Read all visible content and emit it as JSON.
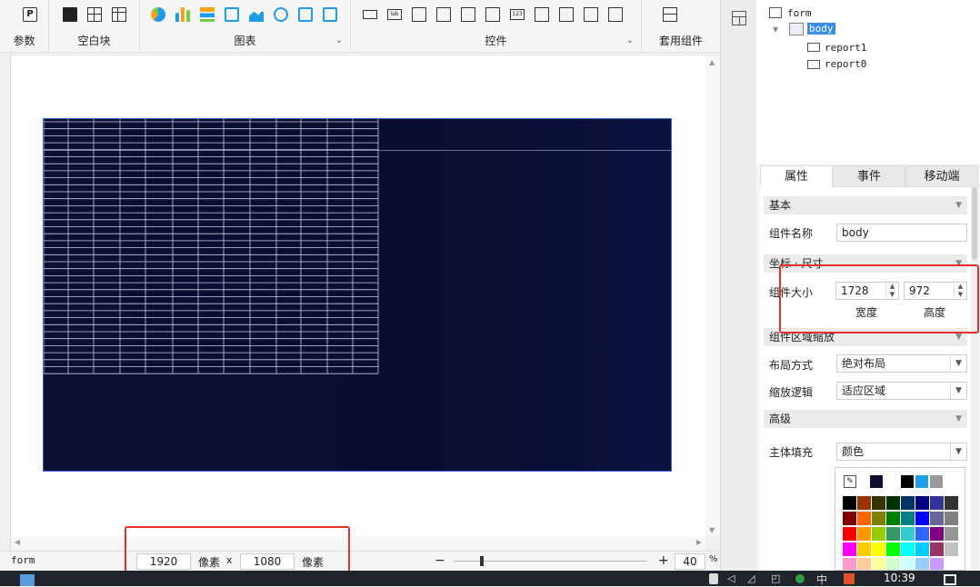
{
  "toolbar": {
    "groups": [
      {
        "label": "参数"
      },
      {
        "label": "空白块"
      },
      {
        "label": "图表"
      },
      {
        "label": "控件"
      },
      {
        "label": "套用组件"
      }
    ],
    "chart_icon_names": [
      "pie-chart-icon",
      "bar-chart-icon",
      "horizontal-bar-icon",
      "line-chart-icon",
      "area-chart-icon",
      "gauge-icon",
      "radar-chart-icon",
      "scatter-chart-icon"
    ],
    "widget_icon_names": [
      "button-icon",
      "label-icon",
      "textbox-icon",
      "combobox-icon",
      "tree-combobox-icon",
      "date-icon",
      "number-icon",
      "textarea-icon",
      "radio-group-icon",
      "checkbox-group-icon",
      "query-icon"
    ],
    "widget_lab_text": "lab",
    "widget_123_text": "123"
  },
  "status": {
    "form_label": "form",
    "width_value": "1920",
    "unit1": "像素",
    "times": "x",
    "height_value": "1080",
    "unit2": "像素",
    "minus": "−",
    "plus": "+",
    "zoom": "40",
    "percent": "%"
  },
  "tree": {
    "root": "form",
    "body": "body",
    "children": [
      "report1",
      "report0"
    ]
  },
  "tabs": [
    "属性",
    "事件",
    "移动端"
  ],
  "props": {
    "basic_section": "基本",
    "name_label": "组件名称",
    "name_value": "body",
    "coord_section": "坐标 · 尺寸",
    "size_label": "组件大小",
    "width_value": "1728",
    "height_value": "972",
    "width_caption": "宽度",
    "height_caption": "高度",
    "scale_section": "组件区域缩放",
    "layout_label": "布局方式",
    "layout_value": "绝对布局",
    "scale_label": "缩放逻辑",
    "scale_value": "适应区域",
    "advanced_section": "高级",
    "fill_label": "主体填充",
    "fill_value": "颜色"
  },
  "palette": {
    "top_row": [
      "#0b0f33",
      "#ffffff",
      "#000000",
      "#1ea0e6",
      "#999999",
      "#ffffff"
    ],
    "rows": [
      [
        "#000000",
        "#993300",
        "#333300",
        "#003300",
        "#003366",
        "#000080",
        "#333399",
        "#333333"
      ],
      [
        "#800000",
        "#ff6600",
        "#808000",
        "#008000",
        "#008080",
        "#0000ff",
        "#666699",
        "#808080"
      ],
      [
        "#ff0000",
        "#ff9900",
        "#99cc00",
        "#339966",
        "#33cccc",
        "#3366ff",
        "#800080",
        "#969696"
      ],
      [
        "#ff00ff",
        "#ffcc00",
        "#ffff00",
        "#00ff00",
        "#00ffff",
        "#00ccff",
        "#993366",
        "#c0c0c0"
      ],
      [
        "#ff99cc",
        "#ffcc99",
        "#ffff99",
        "#ccffcc",
        "#ccffff",
        "#99ccff",
        "#cc99ff",
        "#ffffff"
      ]
    ]
  },
  "taskbar": {
    "time": "10:39",
    "ime": "中"
  },
  "colors": {
    "dashboard_bg": "#0b0f33",
    "selection_blue": "#3a6ad0",
    "highlight_red": "#e53030",
    "tree_selected": "#3a8ee6"
  }
}
